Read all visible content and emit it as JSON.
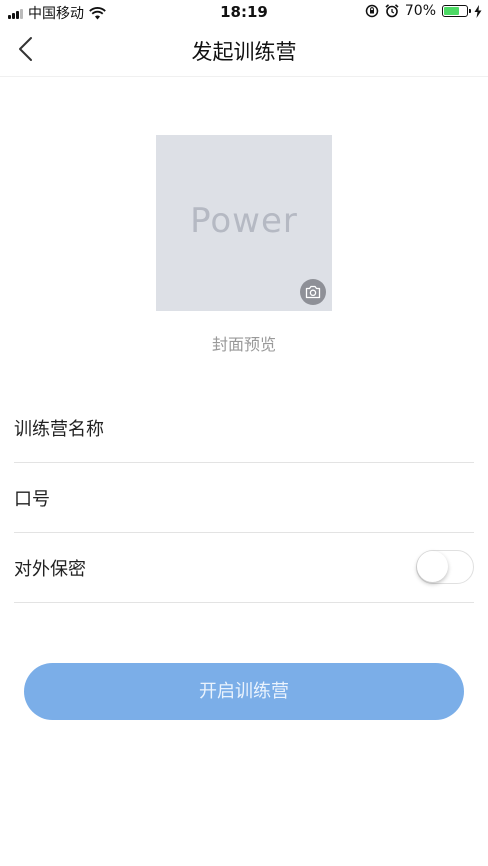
{
  "status_bar": {
    "carrier": "中国移动",
    "time": "18:19",
    "battery": "70%",
    "battery_level": 0.7,
    "icons": [
      "signal-icon",
      "wifi-icon",
      "rotation-lock-icon",
      "alarm-icon",
      "battery-icon",
      "charging-icon"
    ]
  },
  "nav": {
    "title": "发起训练营",
    "back_icon": "chevron-left-icon"
  },
  "cover": {
    "logo_text": "Power",
    "caption": "封面预览",
    "camera_icon": "camera-icon"
  },
  "form": {
    "name_label": "训练营名称",
    "name_value": "",
    "slogan_label": "口号",
    "slogan_value": "",
    "secret_label": "对外保密",
    "secret_enabled": false
  },
  "submit": {
    "label": "开启训练营"
  },
  "colors": {
    "primary_button": "#7baee8",
    "cover_bg": "#dde0e6",
    "battery_green": "#4cd964"
  }
}
